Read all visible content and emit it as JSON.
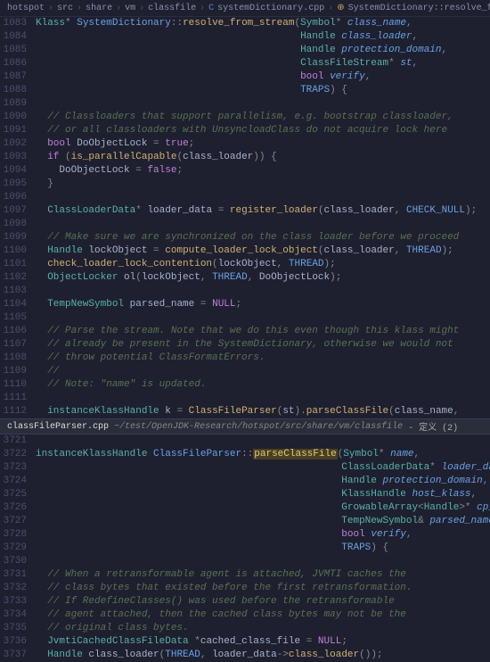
{
  "breadcrumb": {
    "parts": [
      "hotspot",
      "src",
      "share",
      "vm",
      "classfile"
    ],
    "file": "systemDictionary.cpp",
    "symbol": "SystemDictionary::resolve_from_stream(Symbol *, Handle, Handle, ClassFileStre"
  },
  "top_pane": {
    "lines": [
      {
        "n": "1083",
        "html": "<span class='type'>Klass</span><span class='punct'>*</span> <span class='cls'>SystemDictionary</span><span class='punct'>::</span><span class='func'>resolve_from_stream</span><span class='punct'>(</span><span class='type'>Symbol</span><span class='punct'>*</span> <span class='param'>class_name</span><span class='punct'>,</span>"
      },
      {
        "n": "1084",
        "html": "                                             <span class='type'>Handle</span> <span class='param'>class_loader</span><span class='punct'>,</span>"
      },
      {
        "n": "1085",
        "html": "                                             <span class='type'>Handle</span> <span class='param'>protection_domain</span><span class='punct'>,</span>"
      },
      {
        "n": "1086",
        "html": "                                             <span class='type'>ClassFileStream</span><span class='punct'>*</span> <span class='param'>st</span><span class='punct'>,</span>"
      },
      {
        "n": "1087",
        "html": "                                             <span class='kw'>bool</span> <span class='param'>verify</span><span class='punct'>,</span>"
      },
      {
        "n": "1088",
        "html": "                                             <span class='macro'>TRAPS</span><span class='punct'>) {</span>"
      },
      {
        "n": "1089",
        "html": ""
      },
      {
        "n": "1090",
        "html": "  <span class='comment'>// Classloaders that support parallelism, e.g. bootstrap classloader,</span>"
      },
      {
        "n": "1091",
        "html": "  <span class='comment'>// or all classloaders with UnsyncloadClass do not acquire lock here</span>"
      },
      {
        "n": "1092",
        "html": "  <span class='kw'>bool</span> <span class='var'>DoObjectLock</span> <span class='punct'>=</span> <span class='bool'>true</span><span class='punct'>;</span>"
      },
      {
        "n": "1093",
        "html": "  <span class='kw'>if</span> <span class='punct'>(</span><span class='func'>is_parallelCapable</span><span class='punct'>(</span><span class='var'>class_loader</span><span class='punct'>)) {</span>"
      },
      {
        "n": "1094",
        "html": "    <span class='var'>DoObjectLock</span> <span class='punct'>=</span> <span class='bool'>false</span><span class='punct'>;</span>"
      },
      {
        "n": "1095",
        "html": "  <span class='punct'>}</span>"
      },
      {
        "n": "1096",
        "html": ""
      },
      {
        "n": "1097",
        "html": "  <span class='type'>ClassLoaderData</span><span class='punct'>*</span> <span class='var'>loader_data</span> <span class='punct'>=</span> <span class='func'>register_loader</span><span class='punct'>(</span><span class='var'>class_loader</span><span class='punct'>,</span> <span class='macro'>CHECK_NULL</span><span class='punct'>);</span>"
      },
      {
        "n": "1098",
        "html": ""
      },
      {
        "n": "1099",
        "html": "  <span class='comment'>// Make sure we are synchronized on the class loader before we proceed</span>"
      },
      {
        "n": "1100",
        "html": "  <span class='type'>Handle</span> <span class='var'>lockObject</span> <span class='punct'>=</span> <span class='func'>compute_loader_lock_object</span><span class='punct'>(</span><span class='var'>class_loader</span><span class='punct'>,</span> <span class='macro'>THREAD</span><span class='punct'>);</span>"
      },
      {
        "n": "1101",
        "html": "  <span class='func'>check_loader_lock_contention</span><span class='punct'>(</span><span class='var'>lockObject</span><span class='punct'>,</span> <span class='macro'>THREAD</span><span class='punct'>);</span>"
      },
      {
        "n": "1102",
        "html": "  <span class='type'>ObjectLocker</span> <span class='var'>ol</span><span class='punct'>(</span><span class='var'>lockObject</span><span class='punct'>,</span> <span class='macro'>THREAD</span><span class='punct'>,</span> <span class='var'>DoObjectLock</span><span class='punct'>);</span>"
      },
      {
        "n": "1103",
        "html": ""
      },
      {
        "n": "1104",
        "html": "  <span class='type'>TempNewSymbol</span> <span class='var'>parsed_name</span> <span class='punct'>=</span> <span class='null'>NULL</span><span class='punct'>;</span>"
      },
      {
        "n": "1105",
        "html": ""
      },
      {
        "n": "1106",
        "html": "  <span class='comment'>// Parse the stream. Note that we do this even though this klass might</span>"
      },
      {
        "n": "1107",
        "html": "  <span class='comment'>// already be present in the SystemDictionary, otherwise we would not</span>"
      },
      {
        "n": "1108",
        "html": "  <span class='comment'>// throw potential ClassFormatErrors.</span>"
      },
      {
        "n": "1109",
        "html": "  <span class='comment'>//</span>"
      },
      {
        "n": "1110",
        "html": "  <span class='comment'>// Note: \"name\" is updated.</span>"
      },
      {
        "n": "1111",
        "html": ""
      },
      {
        "n": "1112",
        "html": "  <span class='type'>instanceKlassHandle</span> <span class='var'>k</span> <span class='punct'>=</span> <span class='func'>ClassFileParser</span><span class='punct'>(</span><span class='var'>st</span><span class='punct'>).</span><span class='func'>parseClassFile</span><span class='punct'>(</span><span class='var'>class_name</span><span class='punct'>,</span>"
      }
    ]
  },
  "split_tab": {
    "filename": "classFileParser.cpp",
    "path": "~/test/OpenJDK-Research/hotspot/src/share/vm/classfile",
    "suffix": "- 定义 (2)"
  },
  "bottom_pane": {
    "lines": [
      {
        "n": "3721",
        "html": ""
      },
      {
        "n": "3722",
        "html": "<span class='type'>instanceKlassHandle</span> <span class='cls'>ClassFileParser</span><span class='punct'>::</span><span class='highlight'>parseClassFile</span><span class='punct'>(</span><span class='type'>Symbol</span><span class='punct'>*</span> <span class='param'>name</span><span class='punct'>,</span>"
      },
      {
        "n": "3723",
        "html": "                                                    <span class='type'>ClassLoaderData</span><span class='punct'>*</span> <span class='param'>loader_data</span><span class='punct'>,</span>"
      },
      {
        "n": "3724",
        "html": "                                                    <span class='type'>Handle</span> <span class='param'>protection_domain</span><span class='punct'>,</span>"
      },
      {
        "n": "3725",
        "html": "                                                    <span class='type'>KlassHandle</span> <span class='param'>host_klass</span><span class='punct'>,</span>"
      },
      {
        "n": "3726",
        "html": "                                                    <span class='type'>GrowableArray</span><span class='punct'>&lt;</span><span class='type'>Handle</span><span class='punct'>&gt;*</span> <span class='param'>cp_patches</span><span class='punct'>,</span>"
      },
      {
        "n": "3727",
        "html": "                                                    <span class='type'>TempNewSymbol</span><span class='punct'>&amp;</span> <span class='param'>parsed_name</span><span class='punct'>,</span>"
      },
      {
        "n": "3728",
        "html": "                                                    <span class='kw'>bool</span> <span class='param'>verify</span><span class='punct'>,</span>"
      },
      {
        "n": "3729",
        "html": "                                                    <span class='macro'>TRAPS</span><span class='punct'>) {</span>"
      },
      {
        "n": "3730",
        "html": ""
      },
      {
        "n": "3731",
        "html": "  <span class='comment'>// When a retransformable agent is attached, JVMTI caches the</span>"
      },
      {
        "n": "3732",
        "html": "  <span class='comment'>// class bytes that existed before the first retransformation.</span>"
      },
      {
        "n": "3733",
        "html": "  <span class='comment'>// If RedefineClasses() was used before the retransformable</span>"
      },
      {
        "n": "3734",
        "html": "  <span class='comment'>// agent attached, then the cached class bytes may not be the</span>"
      },
      {
        "n": "3735",
        "html": "  <span class='comment'>// original class bytes.</span>"
      },
      {
        "n": "3736",
        "html": "  <span class='type'>JvmtiCachedClassFileData</span> <span class='punct'>*</span><span class='var'>cached_class_file</span> <span class='punct'>=</span> <span class='null'>NULL</span><span class='punct'>;</span>"
      },
      {
        "n": "3737",
        "html": "  <span class='type'>Handle</span> <span class='var'>class_loader</span><span class='punct'>(</span><span class='macro'>THREAD</span><span class='punct'>,</span> <span class='var'>loader_data</span><span class='punct'>-&gt;</span><span class='func'>class_loader</span><span class='punct'>());</span>"
      }
    ]
  }
}
